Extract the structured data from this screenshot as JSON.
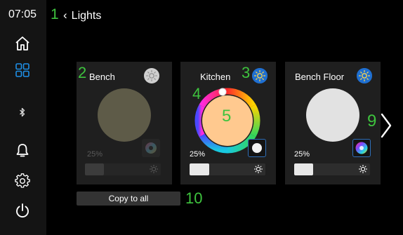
{
  "status": {
    "time": "07:05"
  },
  "header": {
    "title": "Lights"
  },
  "annotations": {
    "a1": "1",
    "a2": "2",
    "a3": "3",
    "a4": "4",
    "a5": "5",
    "a9": "9",
    "a10": "10"
  },
  "cards": [
    {
      "title": "Bench",
      "brightness_label": "25%",
      "brightness": 0.25,
      "state": "off",
      "swatch": "#7d7a62"
    },
    {
      "title": "Kitchen",
      "brightness_label": "25%",
      "brightness": 0.25,
      "state": "on",
      "swatch": "#ffc98f"
    },
    {
      "title": "Bench Floor",
      "brightness_label": "25%",
      "brightness": 0.25,
      "state": "on",
      "swatch": "#e2e2e2"
    }
  ],
  "actions": {
    "copy_label": "Copy to all"
  },
  "colors": {
    "accent_blue": "#1f6fd1",
    "annotation_green": "#3ec33e",
    "sun_yellow": "#ffd84a"
  },
  "icons": [
    "home-icon",
    "grid-icon",
    "bluetooth-icon",
    "bell-icon",
    "gear-icon",
    "power-icon",
    "sun-icon",
    "chevron-right-icon",
    "chevron-left-icon"
  ]
}
